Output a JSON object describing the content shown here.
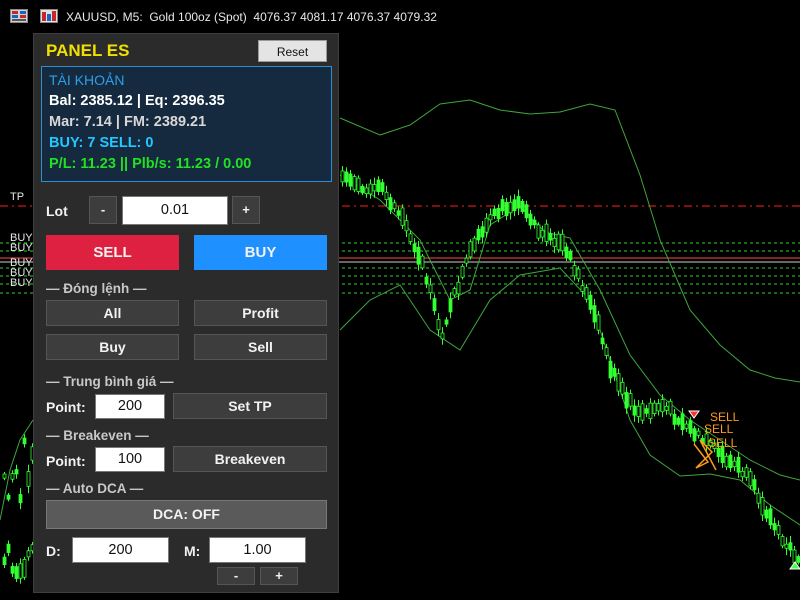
{
  "header": {
    "title": "XAUUSD, M5:  Gold 100oz (Spot)  4076.37 4081.17 4076.37 4079.32"
  },
  "chart_side_labels": [
    "TP",
    "BUY",
    "BUY",
    "BUY",
    "BUY",
    "BUY"
  ],
  "chart_annotations": [
    "SELL",
    "SELL",
    "SELL"
  ],
  "panel": {
    "title": "PANEL ES",
    "reset_label": "Reset",
    "account": {
      "heading": "TÀI KHOẢN",
      "balance_line": "Bal: 2385.12 | Eq: 2396.35",
      "margin_line": "Mar: 7.14 | FM: 2389.21",
      "positions_line": "BUY: 7 SELL: 0",
      "pl_line": "P/L: 11.23 || Plb/s: 11.23 / 0.00"
    },
    "lot": {
      "label": "Lot",
      "minus": "-",
      "value": "0.01",
      "plus": "+"
    },
    "sell_label": "SELL",
    "buy_label": "BUY",
    "close_section": {
      "title": "— Đóng lệnh —",
      "all": "All",
      "profit": "Profit",
      "buy": "Buy",
      "sell": "Sell"
    },
    "average_section": {
      "title": "— Trung bình giá —",
      "point_label": "Point:",
      "point_value": "200",
      "button": "Set TP"
    },
    "breakeven_section": {
      "title": "— Breakeven —",
      "point_label": "Point:",
      "point_value": "100",
      "button": "Breakeven"
    },
    "dca_section": {
      "title": "— Auto DCA —",
      "toggle": "DCA: OFF",
      "d_label": "D:",
      "d_value": "200",
      "m_label": "M:",
      "m_value": "1.00",
      "minus": "-",
      "plus": "+"
    }
  },
  "colors": {
    "candle": "#33ff33",
    "bands": "#3ea63e",
    "tp_line": "#ff2020",
    "buy_lines": "#2fd02f",
    "sell_button": "#de2140",
    "buy_button": "#1e90ff",
    "title_yellow": "#f0e000",
    "sell_arrow": "#ff8c00"
  }
}
